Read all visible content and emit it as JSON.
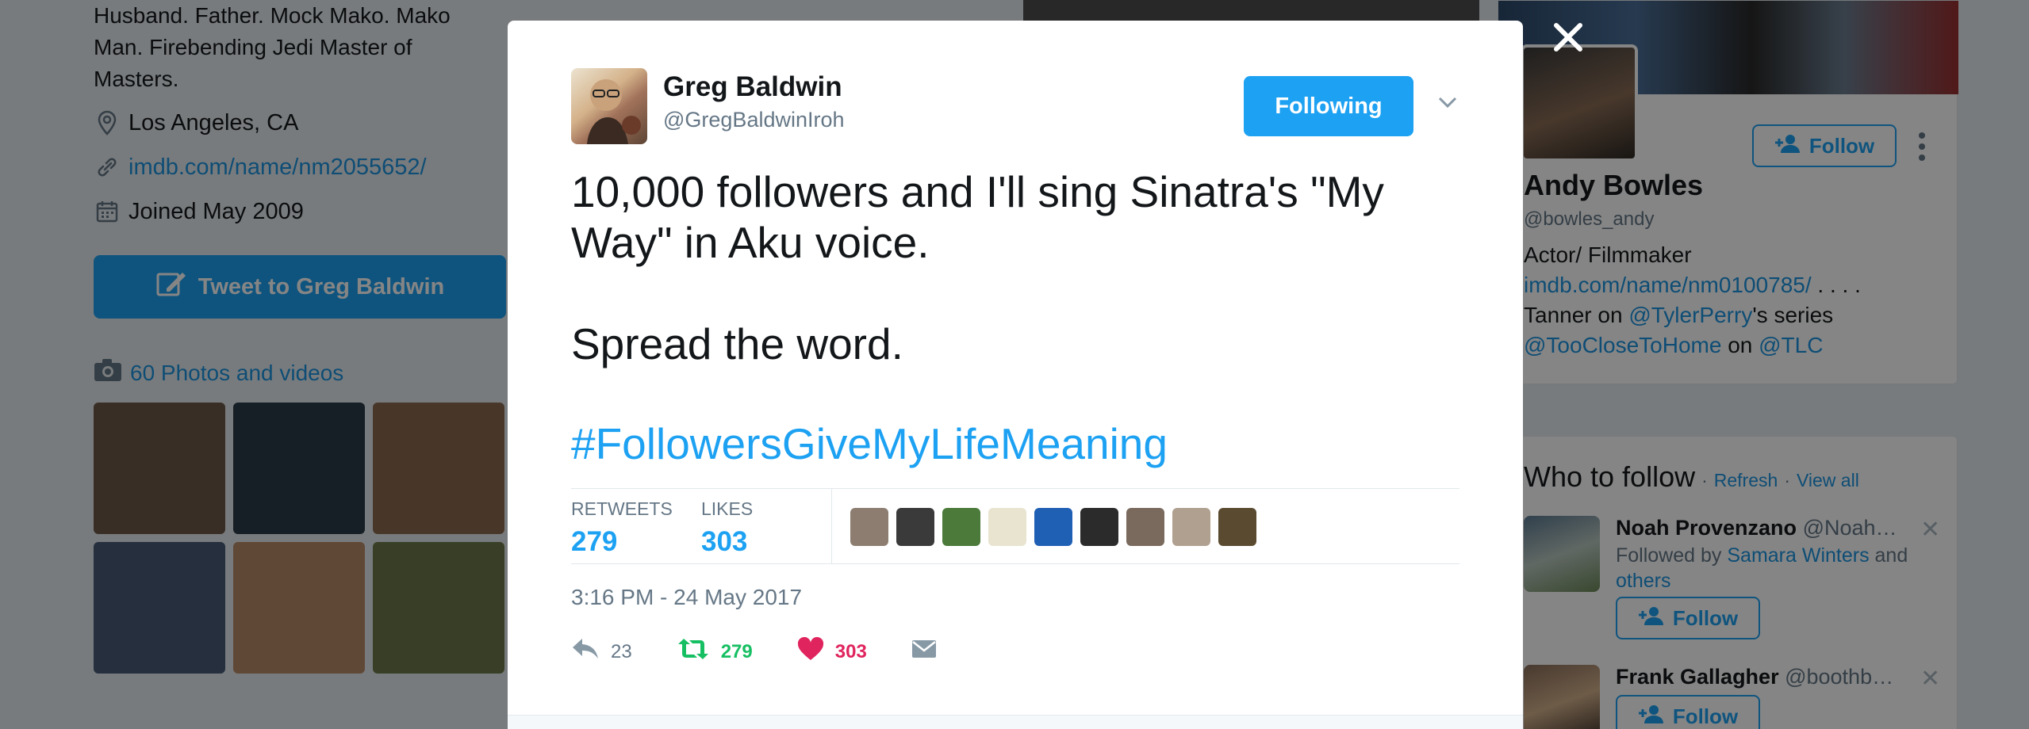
{
  "background": {
    "bio": "Husband. Father. Mock Mako. Mako Man. Firebending Jedi Master of Masters.",
    "location": "Los Angeles, CA",
    "website": "imdb.com/name/nm2055652/",
    "joined": "Joined May 2009",
    "tweet_to_label": "Tweet to Greg Baldwin",
    "photos_label": "60 Photos and videos",
    "thumb_colors": [
      "#6b5848",
      "#2a3c48",
      "#8a6a50",
      "#4a5a78",
      "#b88a6a",
      "#6b7a4a"
    ],
    "profile_card": {
      "follow_label": "Follow",
      "name": "Andy Bowles",
      "handle": "@bowles_andy",
      "bio_line1": "Actor/ Filmmaker",
      "bio_link1": "imdb.com/name/nm0100785/",
      "bio_ellipsis": " . . . .",
      "bio_line3_pre": "Tanner on ",
      "bio_mention1": "@TylerPerry",
      "bio_line3_post": "'s series",
      "bio_mention2": "@TooCloseToHome",
      "bio_on": " on ",
      "bio_mention3": "@TLC"
    },
    "who_to_follow": {
      "title": "Who to follow",
      "sep": "·",
      "refresh": "Refresh",
      "view_all": "View all",
      "suggestions": [
        {
          "name": "Noah Provenzano",
          "handle": "@Noah…",
          "followed_pre": "Followed by ",
          "followed_by": "Samara Winters",
          "followed_post": " and",
          "others": "others",
          "follow_label": "Follow",
          "dismiss": "✕"
        },
        {
          "name": "Frank Gallagher",
          "handle": "@boothb…",
          "follow_label": "Follow",
          "dismiss": "✕"
        }
      ]
    }
  },
  "modal": {
    "author": {
      "name": "Greg Baldwin",
      "handle": "@GregBaldwinIroh"
    },
    "following_label": "Following",
    "tweet": {
      "line1": "10,000 followers and I'll sing Sinatra's \"My Way\" in Aku voice.",
      "line2": "Spread the word.",
      "hashtag": "#FollowersGiveMyLifeMeaning"
    },
    "stats": {
      "retweets_label": "RETWEETS",
      "retweets": "279",
      "likes_label": "LIKES",
      "likes": "303"
    },
    "liker_colors": [
      "#8c7d70",
      "#3a3a3a",
      "#4b7a3a",
      "#e8e4d0",
      "#1f5fb4",
      "#2b2b2b",
      "#7a6a5e",
      "#b0a090",
      "#5a4a30"
    ],
    "timestamp": "3:16 PM - 24 May 2017",
    "actions": {
      "replies": "23",
      "retweets": "279",
      "likes": "303"
    },
    "colors": {
      "accent": "#1da1f2",
      "retweet": "#17bf63",
      "like": "#e0245e"
    }
  }
}
